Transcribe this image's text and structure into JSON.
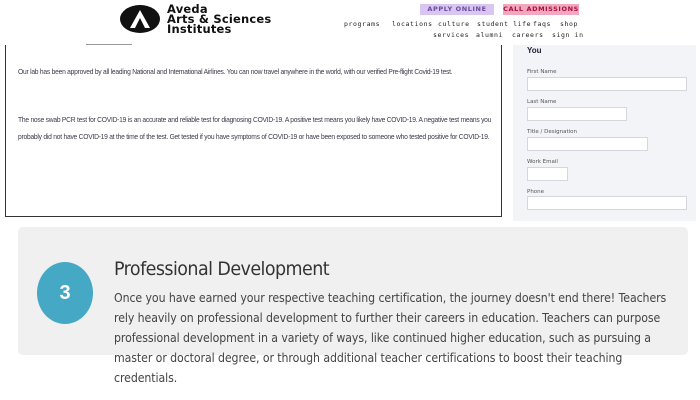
{
  "header": {
    "logo_line1": "Aveda",
    "logo_line2": "Arts & Sciences",
    "logo_line3": "Institutes",
    "apply_label": "APPLY ONLINE",
    "call_label": "CALL ADMISSIONS",
    "nav_primary": [
      "programs",
      "locations",
      "culture",
      "student life",
      "faqs",
      "shop"
    ],
    "nav_secondary": [
      "services",
      "alumni",
      "careers",
      "sign in"
    ]
  },
  "content": {
    "paragraph1": "Our lab has been approved by all leading National and International Airlines. You can now travel anywhere in the world, with our verified Pre-flight Covid-19 test.",
    "paragraph2": "The nose swab PCR test for COVID-19 is an accurate and reliable test for diagnosing COVID-19. A positive test means you likely have COVID-19. A negative test means you probably did not have COVID-19 at the time of the test. Get tested if you have symptoms of COVID-19 or have been exposed to someone who tested positive for COVID-19."
  },
  "form": {
    "title": "You",
    "fields": [
      {
        "label": "First Name"
      },
      {
        "label": "Last Name"
      },
      {
        "label": "Title / Designation"
      },
      {
        "label": "Work Email"
      },
      {
        "label": "Phone"
      }
    ]
  },
  "card": {
    "step_number": "3",
    "title": "Professional Development",
    "body": "Once you have earned your respective teaching certification, the journey doesn't end there! Teachers rely heavily on professional development to further their careers in education. Teachers can purpose professional development in a variety of ways, like continued higher education, such as pursuing a master or doctoral degree, or through additional teacher certifications to boost their teaching credentials.",
    "accent_color": "#45a8c4"
  },
  "colors": {
    "apply_bg": "#d9c6f0",
    "call_bg": "#f2a7c0",
    "form_bg": "#f2f4f8",
    "card_bg": "#f0f0f0"
  }
}
